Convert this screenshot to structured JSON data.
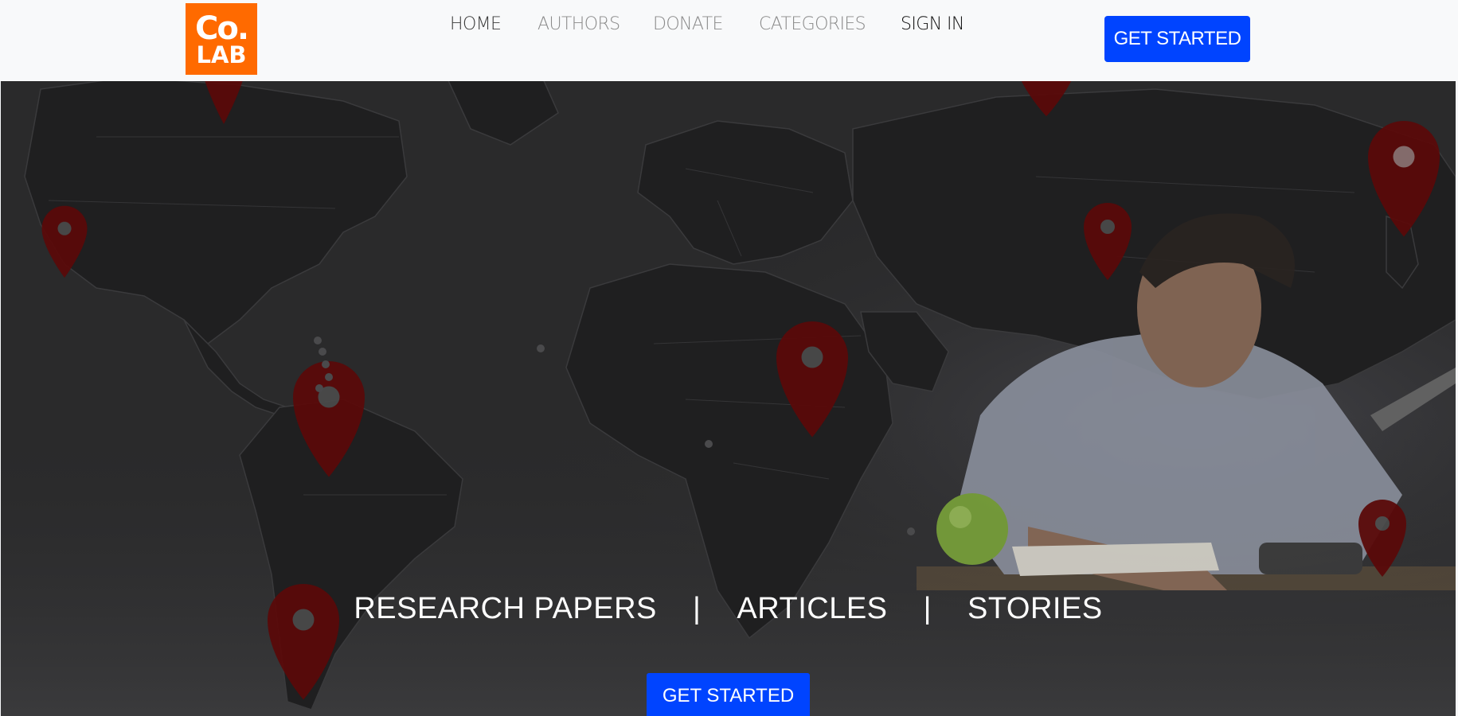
{
  "brand": {
    "logo_line1": "Co.",
    "logo_line2": "LAB",
    "accent": "#ff6a00"
  },
  "nav": {
    "links": [
      {
        "label": "HOME"
      },
      {
        "label": "AUTHORS"
      },
      {
        "label": "DONATE"
      },
      {
        "label": "CATEGORIES"
      },
      {
        "label": "SIGN IN"
      }
    ],
    "cta_label": "GET STARTED",
    "cta_color": "#0044ff"
  },
  "hero": {
    "tagline": {
      "item1": "RESEARCH PAPERS",
      "sep": "|",
      "item2": "ARTICLES",
      "item3": "STORIES"
    },
    "cta_label": "GET STARTED",
    "background": "world-map-with-pins-and-student-writing",
    "pin_color": "#5a0a0a"
  }
}
